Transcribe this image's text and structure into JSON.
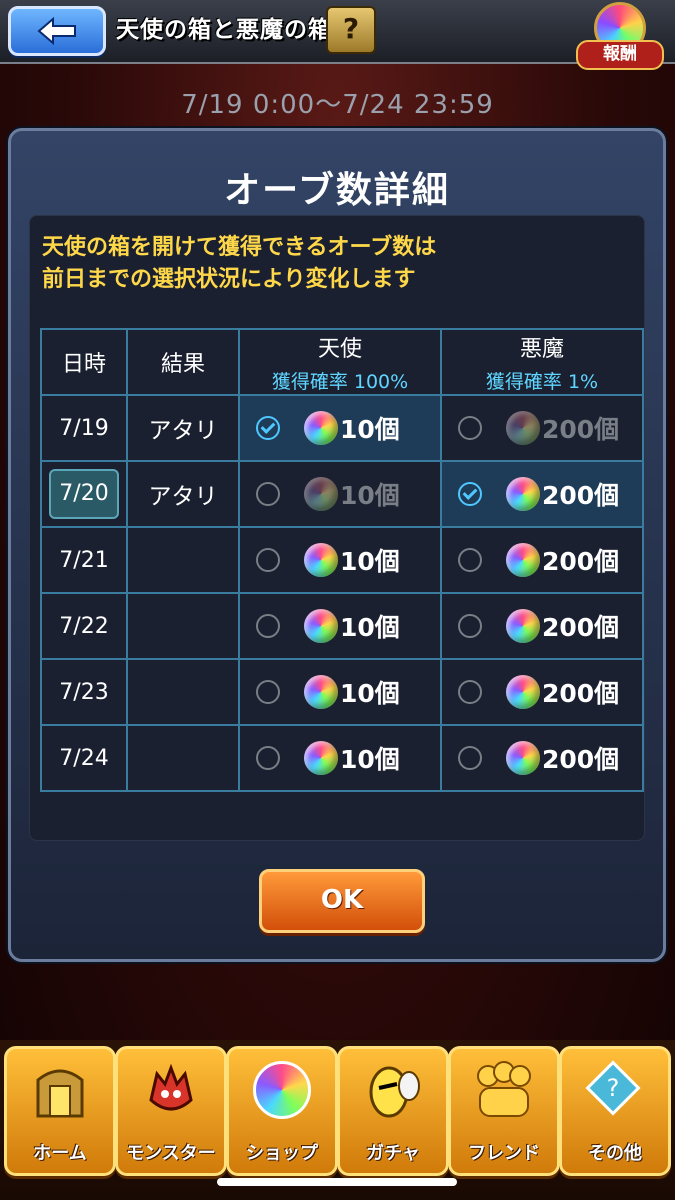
{
  "header": {
    "title": "天使の箱と悪魔の箱",
    "help_label": "?",
    "reward_label": "報酬"
  },
  "period": "7/19 0:00〜7/24 23:59",
  "modal": {
    "title": "オーブ数詳細",
    "description_line1": "天使の箱を開けて獲得できるオーブ数は",
    "description_line2": "前日までの選択状況により変化します",
    "columns": {
      "date": "日時",
      "result": "結果",
      "angel": "天使",
      "angel_rate": "獲得確率 100%",
      "devil": "悪魔",
      "devil_rate": "獲得確率 1%"
    },
    "rows": [
      {
        "date": "7/19",
        "result": "アタリ",
        "angel_amount": "10個",
        "devil_amount": "200個",
        "selected": "angel"
      },
      {
        "date": "7/20",
        "result": "アタリ",
        "angel_amount": "10個",
        "devil_amount": "200個",
        "selected": "devil"
      },
      {
        "date": "7/21",
        "result": "",
        "angel_amount": "10個",
        "devil_amount": "200個",
        "selected": "none"
      },
      {
        "date": "7/22",
        "result": "",
        "angel_amount": "10個",
        "devil_amount": "200個",
        "selected": "none"
      },
      {
        "date": "7/23",
        "result": "",
        "angel_amount": "10個",
        "devil_amount": "200個",
        "selected": "none"
      },
      {
        "date": "7/24",
        "result": "",
        "angel_amount": "10個",
        "devil_amount": "200個",
        "selected": "none"
      }
    ],
    "ok_label": "OK"
  },
  "nav": {
    "home": "ホーム",
    "monster": "モンスター",
    "shop": "ショップ",
    "gacha": "ガチャ",
    "friend": "フレンド",
    "other": "その他"
  }
}
